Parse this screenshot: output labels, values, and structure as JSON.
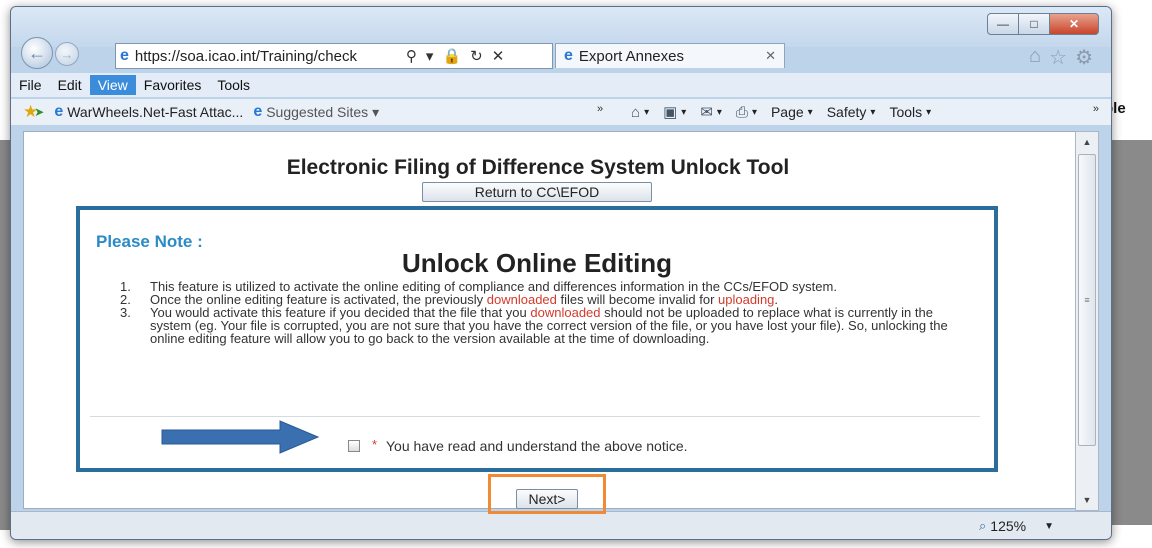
{
  "background": {
    "right_fragment": "ple"
  },
  "browser": {
    "url": "https://soa.icao.int/Training/check",
    "tab_title": "Export Annexes",
    "menu": [
      "File",
      "Edit",
      "View",
      "Favorites",
      "Tools"
    ],
    "active_menu": "View",
    "favorites": [
      "WarWheels.Net-Fast Attac...",
      "Suggested Sites"
    ],
    "command_bar": [
      "Page",
      "Safety",
      "Tools"
    ],
    "zoom": "125%"
  },
  "page": {
    "title": "Electronic Filing of Difference System Unlock Tool",
    "return_button": "Return to CC\\EFOD",
    "please_note": "Please Note :",
    "unlock_heading": "Unlock Online Editing",
    "notes": [
      {
        "num": "1.",
        "text": "This feature is utilized to activate the online editing of compliance and differences information in the CCs/EFOD system."
      },
      {
        "num": "2.",
        "pre": "Once the online editing feature is activated, the previously ",
        "red1": "downloaded",
        "mid": " files will become invalid for ",
        "red2": "uploading",
        "post": "."
      },
      {
        "num": "3.",
        "pre": "You would activate this feature if you decided that the file that you ",
        "red1": "downloaded",
        "post": " should not be uploaded to replace what is currently in the system (eg. Your file is corrupted, you are not sure that you have the correct version of the file, or you have lost your file). So, unlocking the online editing feature will allow you to go back to the version available at the time of downloading."
      }
    ],
    "required_marker": "*",
    "acknowledge": "You have read and understand the above notice.",
    "next_button": "Next>"
  },
  "colors": {
    "notice_border": "#2c6e9b",
    "please_note": "#2b8bc6",
    "highlight": "#d43a2a",
    "next_highlight_box": "#f08a34",
    "arrow": "#3a6fb0"
  }
}
